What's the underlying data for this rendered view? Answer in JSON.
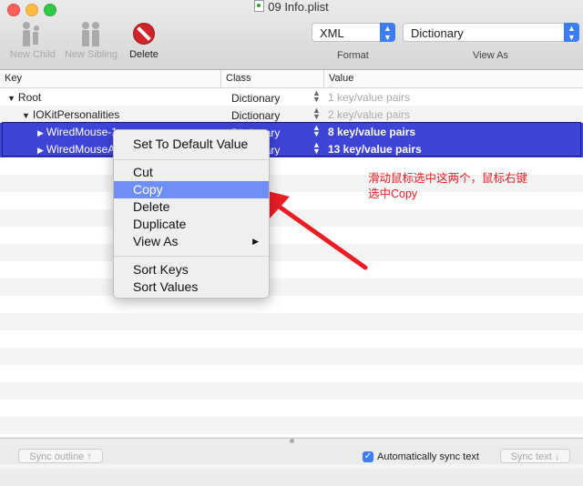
{
  "window": {
    "title": "09 Info.plist"
  },
  "toolbar": {
    "new_child": "New Child",
    "new_sibling": "New Sibling",
    "delete": "Delete",
    "format_value": "XML",
    "format_label": "Format",
    "viewas_value": "Dictionary",
    "viewas_label": "View As"
  },
  "columns": {
    "key": "Key",
    "class": "Class",
    "value": "Value"
  },
  "rows": [
    {
      "key": "Root",
      "class": "Dictionary",
      "value": "1 key/value pairs",
      "expanded": true
    },
    {
      "key": "IOKitPersonalities",
      "class": "Dictionary",
      "value": "2 key/value pairs",
      "expanded": true
    },
    {
      "key": "WiredMouse-1",
      "class": "Dictionary",
      "value": "8 key/value pairs",
      "selected": true
    },
    {
      "key": "WiredMouseA",
      "class": "Dictionary",
      "value": "13 key/value pairs",
      "selected": true
    }
  ],
  "context_menu": {
    "set_default": "Set To Default Value",
    "cut": "Cut",
    "copy": "Copy",
    "delete": "Delete",
    "duplicate": "Duplicate",
    "view_as": "View As",
    "sort_keys": "Sort Keys",
    "sort_values": "Sort Values"
  },
  "annotation": {
    "line1": "滑动鼠标选中这两个，鼠标右键",
    "line2": "选中Copy",
    "color": "#ec1c24"
  },
  "bottom": {
    "sync_outline": "Sync outline ↑",
    "auto_sync": "Automatically sync text",
    "sync_text": "Sync text ↓"
  },
  "colors": {
    "selection": "#3e44d8",
    "menu_highlight": "#6f8ef7",
    "accent": "#3d7df4"
  }
}
